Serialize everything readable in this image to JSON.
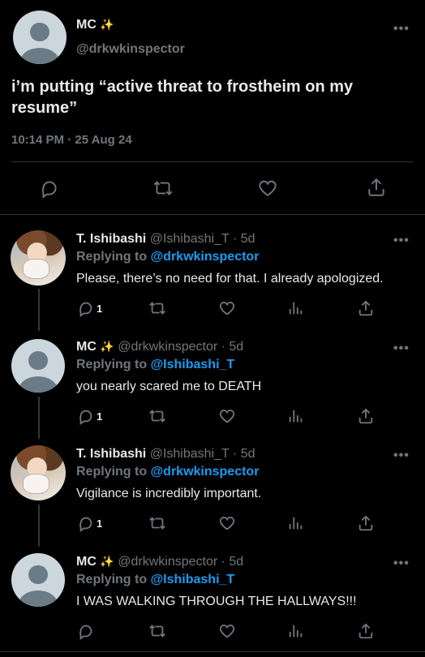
{
  "main_tweet": {
    "name": "MC",
    "emoji": "✨",
    "handle": "@drkwkinspector",
    "text": "i’m putting “active threat to frostheim on my resume”",
    "timestamp": "10:14 PM · 25 Aug 24"
  },
  "replies": [
    {
      "name": "T. Ishibashi",
      "emoji": "",
      "meta": "@Ishibashi_T · 5d",
      "replying_label": "Replying to",
      "replying_to": "@drkwkinspector",
      "text": "Please, there’s no need for that. I already apologized.",
      "reply_count": "1"
    },
    {
      "name": "MC",
      "emoji": "✨",
      "meta": "@drkwkinspector · 5d",
      "replying_label": "Replying to",
      "replying_to": "@Ishibashi_T",
      "text": "you nearly scared me to DEATH",
      "reply_count": "1"
    },
    {
      "name": "T. Ishibashi",
      "emoji": "",
      "meta": "@Ishibashi_T · 5d",
      "replying_label": "Replying to",
      "replying_to": "@drkwkinspector",
      "text": "Vigilance is incredibly important.",
      "reply_count": "1"
    },
    {
      "name": "MC",
      "emoji": "✨",
      "meta": "@drkwkinspector · 5d",
      "replying_label": "Replying to",
      "replying_to": "@Ishibashi_T",
      "text": "I WAS WALKING THROUGH THE HALLWAYS!!!",
      "reply_count": ""
    }
  ],
  "more_glyph": "•••",
  "colors": {
    "background": "#000000",
    "text": "#e7e9ea",
    "muted": "#71767b",
    "accent": "#1d9bf0",
    "divider": "#2f3336"
  },
  "icons": [
    "reply-icon",
    "retweet-icon",
    "like-icon",
    "views-icon",
    "share-icon",
    "more-icon"
  ]
}
